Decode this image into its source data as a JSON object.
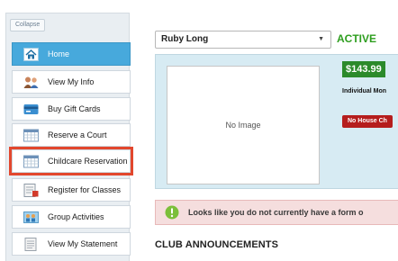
{
  "sidebar": {
    "collapse_label": "Collapse",
    "items": [
      {
        "label": "Home",
        "icon": "home-icon"
      },
      {
        "label": "View My Info",
        "icon": "people-icon"
      },
      {
        "label": "Buy Gift Cards",
        "icon": "gift-card-icon"
      },
      {
        "label": "Reserve a Court",
        "icon": "calendar-icon"
      },
      {
        "label": "Childcare Reservation",
        "icon": "calendar-icon"
      },
      {
        "label": "Register for Classes",
        "icon": "register-icon"
      },
      {
        "label": "Group Activities",
        "icon": "group-icon"
      },
      {
        "label": "View My Statement",
        "icon": "statement-icon"
      }
    ]
  },
  "member": {
    "selected": "Ruby Long",
    "status": "ACTIVE"
  },
  "profile": {
    "no_image": "No Image",
    "balance": "$143.99",
    "plan": "Individual Mon",
    "house_charge": "No House Ch"
  },
  "alert": {
    "text": "Looks like you do not currently have a form o"
  },
  "announcements": {
    "title": "CLUB ANNOUNCEMENTS"
  },
  "colors": {
    "active_nav": "#47a9dc",
    "highlight": "#e2472d",
    "status_green": "#2e9e1f",
    "balance_bg": "#2b8a2b",
    "no_house_bg": "#b51d1d"
  }
}
